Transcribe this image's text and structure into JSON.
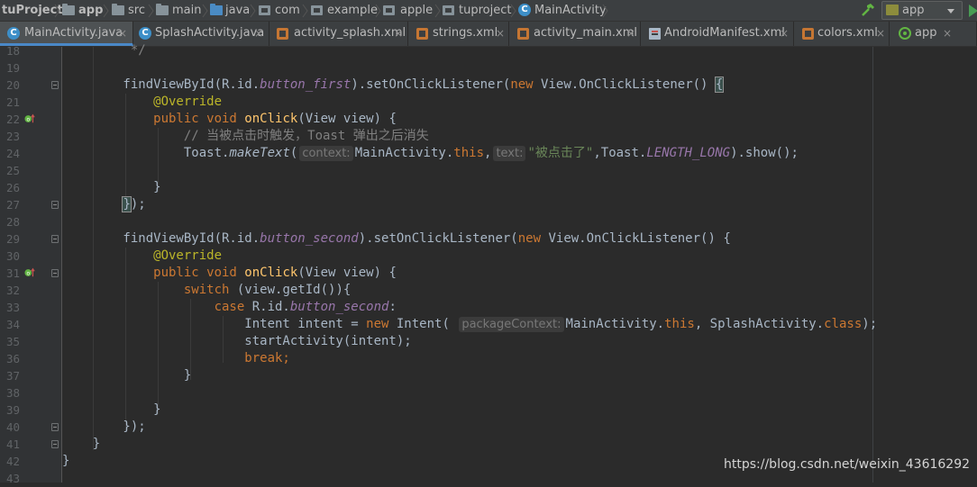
{
  "breadcrumbs": [
    {
      "label": "tuProject",
      "icon": "none"
    },
    {
      "label": "app",
      "icon": "module-folder-icon"
    },
    {
      "label": "src",
      "icon": "folder-icon"
    },
    {
      "label": "main",
      "icon": "folder-icon"
    },
    {
      "label": "java",
      "icon": "source-folder-icon"
    },
    {
      "label": "com",
      "icon": "package-icon"
    },
    {
      "label": "example",
      "icon": "package-icon"
    },
    {
      "label": "apple",
      "icon": "package-icon"
    },
    {
      "label": "tuproject",
      "icon": "package-icon"
    },
    {
      "label": "MainActivity",
      "icon": "class-icon"
    }
  ],
  "toolbar": {
    "run_config": "app",
    "class_icon_letter": "C"
  },
  "tabs": [
    {
      "label": "MainActivity.java",
      "icon": "java-class-icon",
      "active": true
    },
    {
      "label": "SplashActivity.java",
      "icon": "java-class-icon",
      "active": false
    },
    {
      "label": "activity_splash.xml",
      "icon": "xml-icon",
      "active": false
    },
    {
      "label": "strings.xml",
      "icon": "xml-icon",
      "active": false
    },
    {
      "label": "activity_main.xml",
      "icon": "xml-icon",
      "active": false
    },
    {
      "label": "AndroidManifest.xml",
      "icon": "manifest-icon",
      "active": false
    },
    {
      "label": "colors.xml",
      "icon": "xml-icon",
      "active": false
    },
    {
      "label": "app",
      "icon": "gradle-icon",
      "active": false
    }
  ],
  "tab_close_glyph": "×",
  "editor": {
    "line_numbers": [
      "18",
      "19",
      "20",
      "21",
      "22",
      "23",
      "24",
      "25",
      "26",
      "27",
      "28",
      "29",
      "30",
      "31",
      "32",
      "33",
      "34",
      "35",
      "36",
      "37",
      "38",
      "39",
      "40",
      "41",
      "42",
      "43"
    ],
    "lines": [
      {
        "n": "18",
        "t": [
          {
            "c": "cm",
            "v": "         */"
          }
        ]
      },
      {
        "n": "19",
        "t": []
      },
      {
        "n": "20",
        "t": [
          {
            "c": "",
            "v": "        findViewById(R.id."
          },
          {
            "c": "fld",
            "v": "button_first"
          },
          {
            "c": "",
            "v": ").setOnClickListener("
          },
          {
            "c": "kw",
            "v": "new "
          },
          {
            "c": "",
            "v": "View.OnClickListener() "
          },
          {
            "c": "bmatch",
            "v": "{"
          }
        ]
      },
      {
        "n": "21",
        "t": [
          {
            "c": "an",
            "v": "            @Override"
          }
        ]
      },
      {
        "n": "22",
        "t": [
          {
            "c": "kw",
            "v": "            public void "
          },
          {
            "c": "fn",
            "v": "onClick"
          },
          {
            "c": "",
            "v": "(View view) {"
          }
        ]
      },
      {
        "n": "23",
        "t": [
          {
            "c": "cm",
            "v": "                // 当被点击时触发，Toast 弹出之后消失"
          }
        ]
      },
      {
        "n": "24",
        "t": [
          {
            "c": "",
            "v": "                Toast."
          },
          {
            "c": "it",
            "v": "makeText"
          },
          {
            "c": "",
            "v": "("
          },
          {
            "c": "hint",
            "v": "context:"
          },
          {
            "c": "",
            "v": "MainActivity."
          },
          {
            "c": "kw",
            "v": "this"
          },
          {
            "c": "",
            "v": ","
          },
          {
            "c": "hint",
            "v": "text:"
          },
          {
            "c": "st",
            "v": "\"被点击了\""
          },
          {
            "c": "",
            "v": ",Toast."
          },
          {
            "c": "fld",
            "v": "LENGTH_LONG"
          },
          {
            "c": "",
            "v": ").show();"
          }
        ]
      },
      {
        "n": "25",
        "t": []
      },
      {
        "n": "26",
        "t": [
          {
            "c": "",
            "v": "            }"
          }
        ]
      },
      {
        "n": "27",
        "t": [
          {
            "c": "",
            "v": "        "
          },
          {
            "c": "bmatch",
            "v": "}"
          },
          {
            "c": "",
            "v": ");"
          }
        ]
      },
      {
        "n": "28",
        "t": []
      },
      {
        "n": "29",
        "t": [
          {
            "c": "",
            "v": "        findViewById(R.id."
          },
          {
            "c": "fld",
            "v": "button_second"
          },
          {
            "c": "",
            "v": ").setOnClickListener("
          },
          {
            "c": "kw",
            "v": "new "
          },
          {
            "c": "",
            "v": "View.OnClickListener() {"
          }
        ]
      },
      {
        "n": "30",
        "t": [
          {
            "c": "an",
            "v": "            @Override"
          }
        ]
      },
      {
        "n": "31",
        "t": [
          {
            "c": "kw",
            "v": "            public void "
          },
          {
            "c": "fn",
            "v": "onClick"
          },
          {
            "c": "",
            "v": "(View view) {"
          }
        ]
      },
      {
        "n": "32",
        "t": [
          {
            "c": "kw",
            "v": "                switch "
          },
          {
            "c": "",
            "v": "(view.getId()){"
          }
        ]
      },
      {
        "n": "33",
        "t": [
          {
            "c": "kw",
            "v": "                    case "
          },
          {
            "c": "",
            "v": "R.id."
          },
          {
            "c": "fld",
            "v": "button_second"
          },
          {
            "c": "",
            "v": ":"
          }
        ]
      },
      {
        "n": "34",
        "t": [
          {
            "c": "",
            "v": "                        Intent intent = "
          },
          {
            "c": "kw",
            "v": "new "
          },
          {
            "c": "",
            "v": "Intent( "
          },
          {
            "c": "hint",
            "v": "packageContext:"
          },
          {
            "c": "",
            "v": "MainActivity."
          },
          {
            "c": "kw",
            "v": "this"
          },
          {
            "c": "",
            "v": ", SplashActivity."
          },
          {
            "c": "kw",
            "v": "class"
          },
          {
            "c": "",
            "v": ");"
          }
        ]
      },
      {
        "n": "35",
        "t": [
          {
            "c": "",
            "v": "                        startActivity(intent);"
          }
        ]
      },
      {
        "n": "36",
        "t": [
          {
            "c": "kw",
            "v": "                        break;"
          }
        ]
      },
      {
        "n": "37",
        "t": [
          {
            "c": "",
            "v": "                }"
          }
        ]
      },
      {
        "n": "38",
        "t": []
      },
      {
        "n": "39",
        "t": [
          {
            "c": "",
            "v": "            }"
          }
        ]
      },
      {
        "n": "40",
        "t": [
          {
            "c": "",
            "v": "        });"
          }
        ]
      },
      {
        "n": "41",
        "t": [
          {
            "c": "",
            "v": "    }"
          }
        ]
      },
      {
        "n": "42",
        "t": [
          {
            "c": "",
            "v": "}"
          }
        ]
      },
      {
        "n": "43",
        "t": []
      }
    ],
    "fold_lines": [
      "20",
      "27",
      "29",
      "31",
      "40",
      "41"
    ],
    "override_lines": [
      "22",
      "31"
    ]
  },
  "watermark": "https://blog.csdn.net/weixin_43616292",
  "colors": {
    "keyword": "#cc7832",
    "method": "#ffc66d",
    "field": "#9876aa",
    "string": "#6a8759",
    "comment": "#808080",
    "annotation": "#bbb529",
    "text": "#a9b7c6",
    "background": "#2b2b2b"
  }
}
